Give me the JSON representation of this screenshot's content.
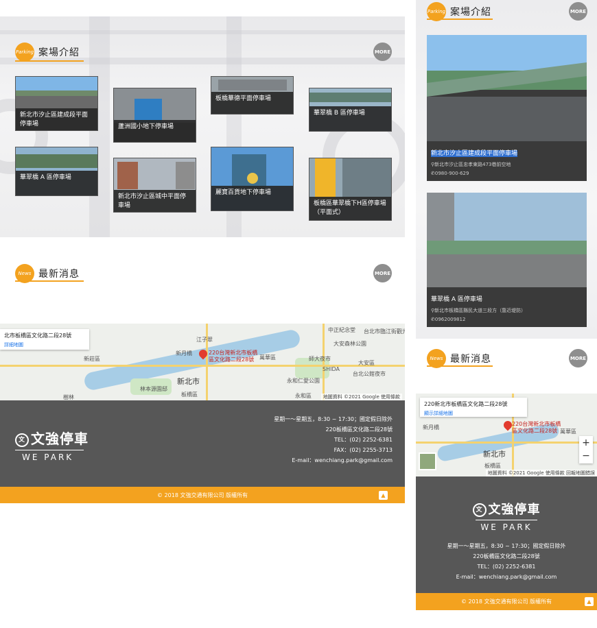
{
  "desktop": {
    "parking_section": {
      "badge": "Parking",
      "title": "案場介紹",
      "more": "MORE",
      "tiles": [
        {
          "label": "新北市汐止區建成段平面停車場"
        },
        {
          "label": "蘆洲國小地下停車場"
        },
        {
          "label": "板橋華德平面停車場"
        },
        {
          "label": "華翠橋 B 區停車場"
        },
        {
          "label": "華翠橋 A 區停車場"
        },
        {
          "label": "新北市汐止區城中平面停車場"
        },
        {
          "label": "麗寶百貨地下停車場"
        },
        {
          "label": "板橋區華翠橋下H區停車場（平面式）"
        }
      ]
    },
    "news_section": {
      "badge": "News",
      "title": "最新消息",
      "more": "MORE"
    },
    "map": {
      "infobox_title": "北市板橋區文化路二段28號",
      "infobox_link": "詳細地圖",
      "pin_label": "220台灣新北市板橋區文化路二段28號",
      "attribution": "地圖資料 ©2021 Google   使用條款",
      "labels": [
        "中正紀念堂",
        "台北市臨江街觀光夜市",
        "大安森林公園",
        "新莊區",
        "江子翠",
        "萬華區",
        "新月橋",
        "師大夜市",
        "大安區",
        "新北市",
        "永和仁愛公園",
        "SHIDA",
        "台北公館夜市",
        "林本源園邸",
        "板橋區",
        "永和區",
        "樹林"
      ]
    },
    "footer": {
      "logo_cn": "文強停車",
      "logo_en": "WE PARK",
      "hours": "星期一～星期五，8:30 ~ 17:30；國定假日除外",
      "address": "220板橋區文化路二段28號",
      "tel": "TEL：(02) 2252-6381",
      "fax": "FAX：(02) 2255-3713",
      "email": "E-mail：wenchiang.park@gmail.com",
      "copyright": "© 2018 文強交通有限公司 版權所有",
      "totop": "▲"
    }
  },
  "mobile": {
    "parking_section": {
      "badge": "Parking",
      "title": "案場介紹",
      "more": "MORE"
    },
    "cards": [
      {
        "name": "新北市汐止區建成段平面停車場",
        "address": "新北市汐止區忠孝東路473巷前空地",
        "phone": "0980-900-629"
      },
      {
        "name": "華翠橋 A 區停車場",
        "address": "新北市板橋區縣民大道三段方（靠近堤防）",
        "phone": "0962009812"
      }
    ],
    "news_section": {
      "badge": "News",
      "title": "最新消息",
      "more": "MORE"
    },
    "map": {
      "infobox_title": "220新北市板橋區文化路二段28號",
      "infobox_link": "顯示詳細地圖",
      "pin_label": "220台灣新北市板橋區文化路二段28號",
      "attribution": "地圖資料 ©2021 Google   使用條款   回報地圖錯誤",
      "zoom_in": "+",
      "zoom_out": "−",
      "labels": [
        "新月橋",
        "萬華區",
        "新北市",
        "板橋區"
      ]
    },
    "footer": {
      "logo_cn": "文強停車",
      "logo_en": "WE PARK",
      "hours": "星期一～星期五，8:30 ~ 17:30；國定假日除外",
      "address": "220板橋區文化路二段28號",
      "tel": "TEL：(02) 2252-6381",
      "email": "E-mail：wenchiang.park@gmail.com",
      "copyright": "© 2018 文強交通有限公司 版權所有",
      "totop": "▲"
    }
  }
}
